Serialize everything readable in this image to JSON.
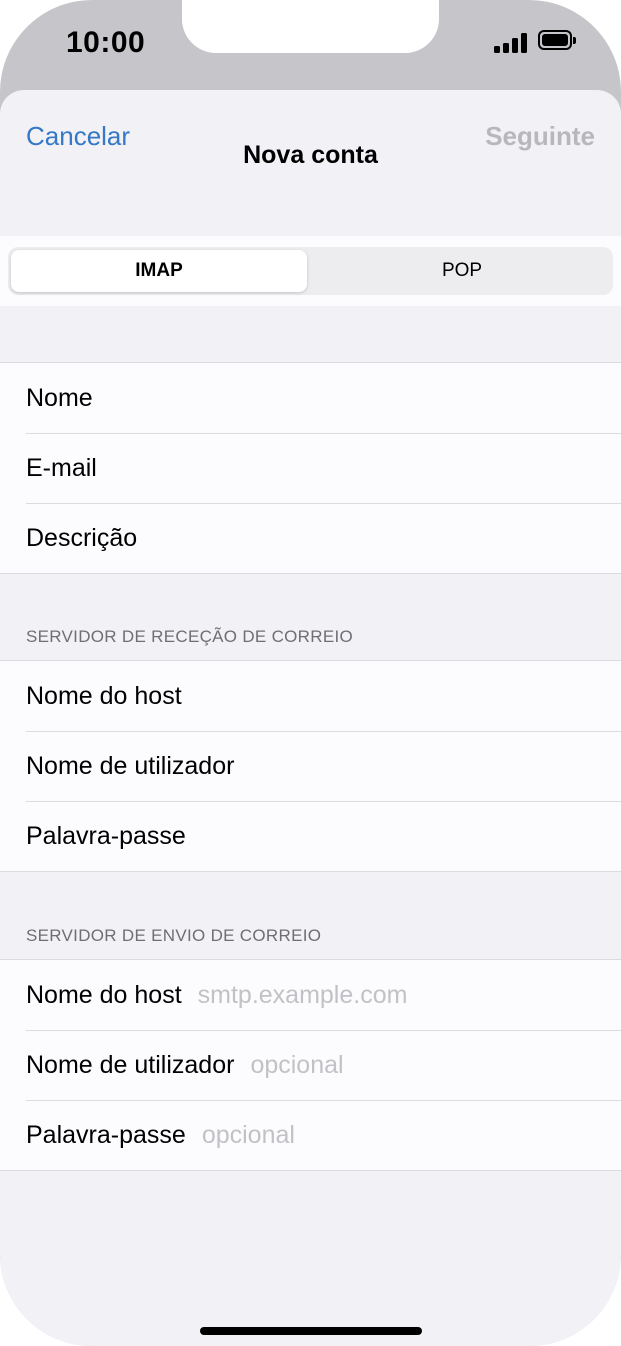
{
  "status_bar": {
    "time": "10:00"
  },
  "nav": {
    "cancel_label": "Cancelar",
    "title": "Nova conta",
    "next_label": "Seguinte"
  },
  "segmented": {
    "options": [
      "IMAP",
      "POP"
    ],
    "selected": "IMAP"
  },
  "account": {
    "rows": [
      {
        "label": "Nome"
      },
      {
        "label": "E-mail"
      },
      {
        "label": "Descrição"
      }
    ]
  },
  "incoming": {
    "header": "SERVIDOR DE RECEÇÃO DE CORREIO",
    "rows": [
      {
        "label": "Nome do host"
      },
      {
        "label": "Nome de utilizador"
      },
      {
        "label": "Palavra-passe"
      }
    ]
  },
  "outgoing": {
    "header": "SERVIDOR DE ENVIO DE CORREIO",
    "rows": [
      {
        "label": "Nome do host",
        "placeholder": "smtp.example.com"
      },
      {
        "label": "Nome de utilizador",
        "placeholder": "opcional"
      },
      {
        "label": "Palavra-passe",
        "placeholder": "opcional"
      }
    ]
  },
  "colors": {
    "accent": "#3478c6",
    "disabled": "#b8b8bc",
    "background": "#f1f1f6"
  },
  "icons": [
    "signal-icon",
    "battery-icon"
  ]
}
